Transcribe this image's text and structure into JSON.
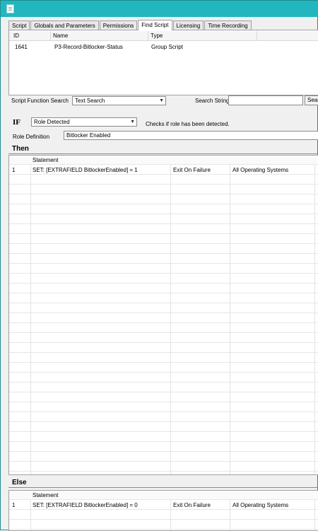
{
  "tabs": [
    "Script",
    "Globals and Parameters",
    "Permissions",
    "Find Script",
    "Licensing",
    "Time Recording"
  ],
  "active_tab": "Find Script",
  "results": {
    "columns": [
      "ID",
      "Name",
      "Type"
    ],
    "rows": [
      {
        "id": "1641",
        "name": "P3-Record-Bitlocker-Status",
        "type": "Group Script"
      }
    ]
  },
  "search": {
    "function_label": "Script Function Search",
    "mode_value": "Text Search",
    "string_label": "Search String",
    "string_value": "",
    "button_label": "Sear"
  },
  "condition": {
    "if_label": "IF",
    "function_value": "Role Detected",
    "description": "Checks if role has been detected.",
    "role_label": "Role Definition",
    "role_value": "Bitlocker Enabled"
  },
  "then": {
    "title": "Then",
    "header": "Statement",
    "rows": [
      {
        "num": "1",
        "statement": "SET:  [EXTRAFIELD BitlockerEnabled]  = 1",
        "failure": "Exit On Failure",
        "os": "All Operating Systems"
      }
    ]
  },
  "else": {
    "title": "Else",
    "header": "Statement",
    "rows": [
      {
        "num": "1",
        "statement": "SET:  [EXTRAFIELD BitlockerEnabled]  = 0",
        "failure": "Exit On Failure",
        "os": "All Operating Systems"
      }
    ]
  },
  "colors": {
    "titlebar": "#22b7bf",
    "window_bg": "#f0f0f0"
  }
}
